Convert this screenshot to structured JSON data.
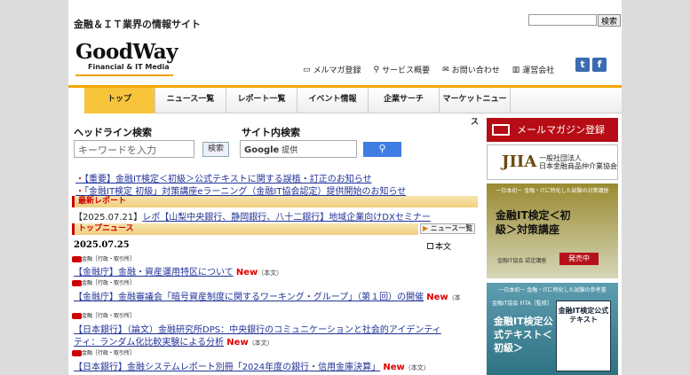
{
  "header": {
    "tagline": "金融＆ＩＴ業界の情報サイト",
    "search_button": "検索",
    "logo_text": "GoodWay",
    "logo_sub": "Financial & IT Media",
    "util_links": [
      {
        "icon": "mail-icon",
        "label": "メルマガ登録"
      },
      {
        "icon": "search-icon",
        "label": "サービス概要"
      },
      {
        "icon": "envelope-icon",
        "label": "お問い合わせ"
      },
      {
        "icon": "building-icon",
        "label": "運営会社"
      }
    ],
    "social": [
      {
        "icon": "twitter-icon",
        "glyph": "t"
      },
      {
        "icon": "facebook-icon",
        "glyph": "f"
      }
    ]
  },
  "nav": {
    "tabs": [
      "トップ",
      "ニュース一覧",
      "レポート一覧",
      "イベント情報",
      "企業サーチ",
      "マーケットニュース"
    ]
  },
  "search": {
    "headline_label": "ヘッドライン検索",
    "keyword_placeholder": "キーワードを入力",
    "keyword_button": "検索",
    "site_label": "サイト内検索",
    "google_text": "Google",
    "google_sub": "提供"
  },
  "notices": [
    "【重要】金融IT検定＜初級＞公式テキストに関する誤植・訂正のお知らせ",
    "「金融IT検定 初級」対策講座eラーニング（金融IT協会認定）提供開始のお知らせ"
  ],
  "latest_report": {
    "heading": "最新レポート",
    "date": "【2025.07.21】",
    "title": "レポ【山梨中央銀行、静岡銀行、八十二銀行】地域企業向けDXセミナー"
  },
  "top_news": {
    "heading": "トップニュース",
    "list_button": "ニュース一覧",
    "date": "2025.07.25",
    "body_toggle": "本文",
    "items": [
      {
        "tag": "金融［行政・取引所］",
        "title": "【金融庁】金融・資産運用特区について",
        "new": "New",
        "body": "（本文）"
      },
      {
        "tag": "金融［行政・取引所］",
        "title": "【金融庁】金融審議会「暗号資産制度に関するワーキング・グループ」（第１回）の開催",
        "new": "New",
        "body": "（本"
      },
      {
        "tag": "金融［行政・取引所］",
        "title": "【日本銀行】（論文）金融研究所DPS：中央銀行のコミュニケーションと社会的アイデンティ",
        "title2": "ティ：ランダム化比較実験による分析",
        "new": "New",
        "body": "（本文）"
      },
      {
        "tag": "金融［行政・取引所］",
        "title": "【日本銀行】金融システムレポート別冊「2024年度の銀行・信用金庫決算」",
        "new": "New",
        "body": "（本文）"
      }
    ]
  },
  "sidebar": {
    "mailmag": "メールマガジン登録",
    "jiia_mark": "JIIA",
    "jiia_name1": "一般社団法人",
    "jiia_name2": "日本金融商品仲介業協会",
    "ad1_caption": "一日本初ー 金融・ITに特化した試験の対策講座",
    "ad1_title": "金融IT検定＜初級＞対策講座",
    "ad1_label": "金融IT協会 認定講座",
    "ad1_badge": "発売中",
    "ad2_caption": "一日本初ー 金融・ITに特化した試験の参考書",
    "ad2_label": "金融IT協会 FITA［監修］",
    "ad2_title": "金融IT検定公式テキスト＜初級＞",
    "ad2_book": "金融IT検定公式テキスト"
  },
  "colors": {
    "accent": "#f5a800",
    "brand_red": "#b70c15",
    "link": "#223399"
  }
}
